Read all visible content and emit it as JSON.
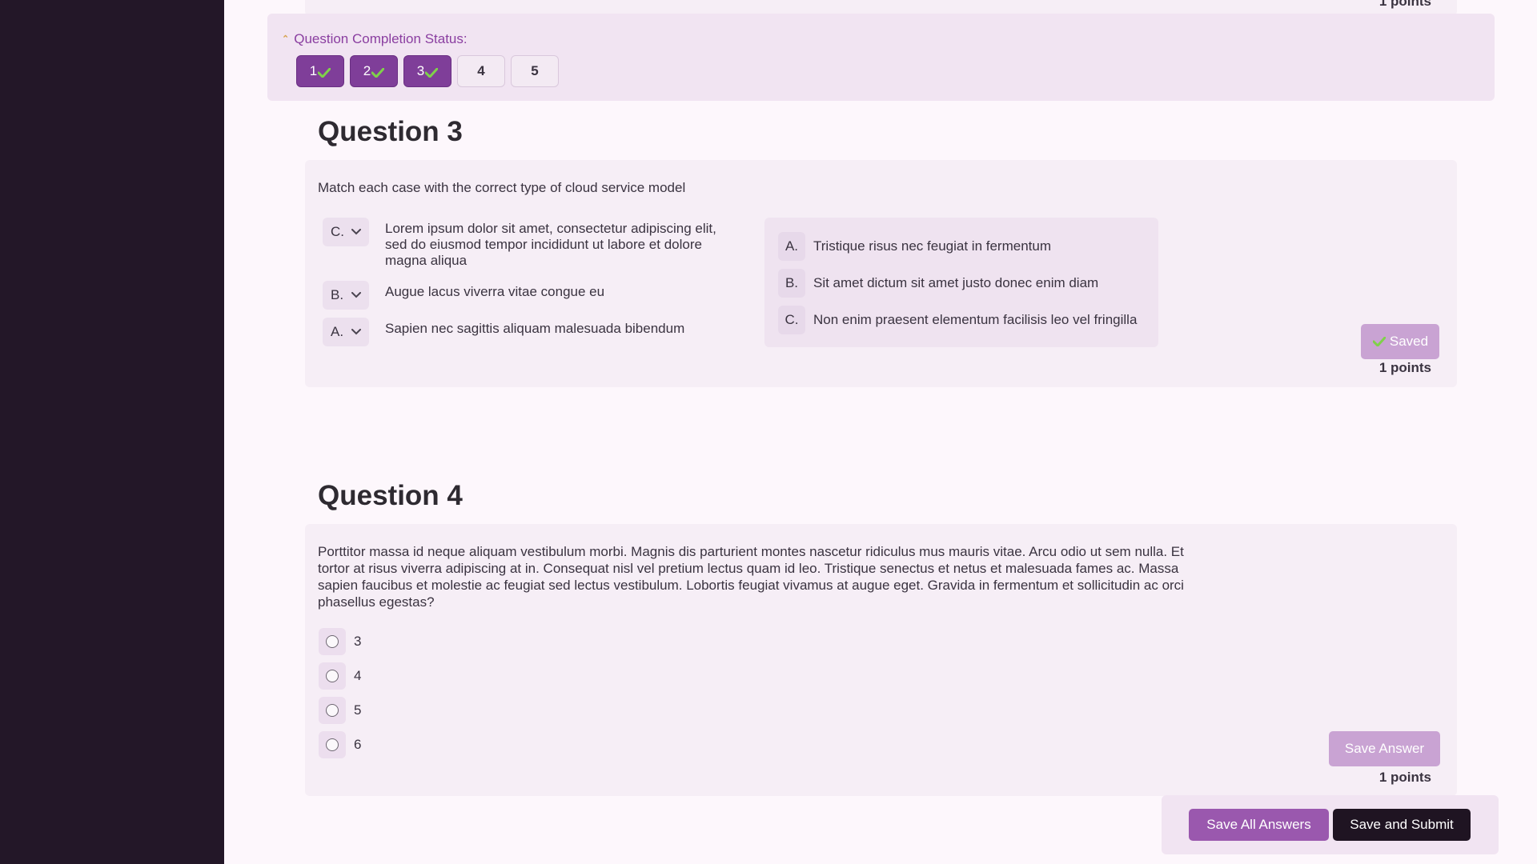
{
  "previous_question": {
    "points": "1 points"
  },
  "completion_status": {
    "title": "Question Completion Status:",
    "questions": [
      {
        "label": "1",
        "done": true
      },
      {
        "label": "2",
        "done": true
      },
      {
        "label": "3",
        "done": true
      },
      {
        "label": "4",
        "done": false
      },
      {
        "label": "5",
        "done": false
      }
    ]
  },
  "question3": {
    "heading": "Question 3",
    "prompt": "Match each case with the correct type of cloud service model",
    "matches": [
      {
        "selected": "C.",
        "text": "Lorem ipsum dolor sit amet, consectetur adipiscing elit, sed do eiusmod tempor incididunt ut labore et dolore magna aliqua"
      },
      {
        "selected": "B.",
        "text": "Augue lacus viverra vitae congue eu"
      },
      {
        "selected": "A.",
        "text": "Sapien nec sagittis aliquam malesuada bibendum"
      }
    ],
    "options": [
      {
        "letter": "A.",
        "text": "Tristique risus nec feugiat in fermentum"
      },
      {
        "letter": "B.",
        "text": "Sit amet dictum sit amet justo donec enim diam"
      },
      {
        "letter": "C.",
        "text": "Non enim praesent elementum facilisis leo vel fringilla"
      }
    ],
    "saved_label": "Saved",
    "points": "1 points"
  },
  "question4": {
    "heading": "Question 4",
    "prompt": "Porttitor massa id neque aliquam vestibulum morbi. Magnis dis parturient montes nascetur ridiculus mus mauris vitae. Arcu odio ut sem nulla. Et tortor at risus viverra adipiscing at in. Consequat nisl vel pretium lectus quam id leo. Tristique senectus et netus et malesuada fames ac. Massa sapien faucibus et molestie ac feugiat sed lectus vestibulum. Lobortis feugiat vivamus at augue eget. Gravida in fermentum et sollicitudin ac orci phasellus egestas?",
    "choices": [
      "3",
      "4",
      "5",
      "6"
    ],
    "save_label": "Save Answer",
    "points": "1 points"
  },
  "footer": {
    "save_all_label": "Save All Answers",
    "submit_label": "Save and Submit"
  },
  "colors": {
    "sidebar": "#231728",
    "accent": "#7f3e99",
    "check": "#7fd14a"
  }
}
